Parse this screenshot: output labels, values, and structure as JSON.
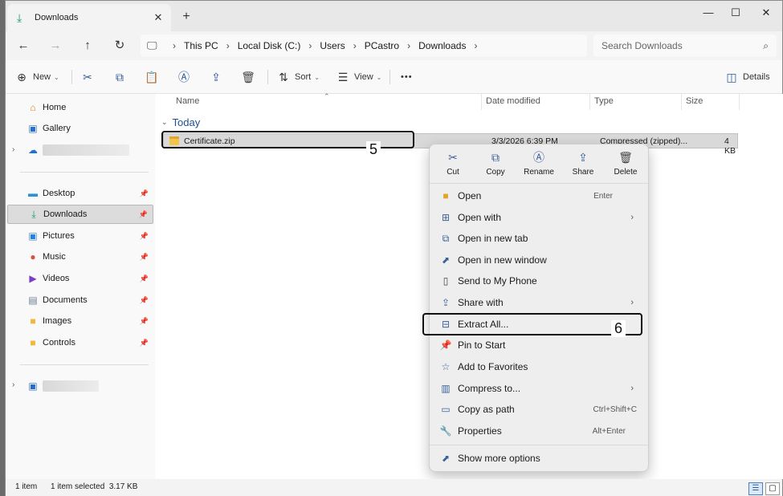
{
  "tab": {
    "title": "Downloads",
    "close": "✕",
    "new": "+"
  },
  "window_controls": {
    "minimize": "—",
    "maximize": "☐",
    "close": "✕"
  },
  "nav": {
    "back": "←",
    "forward": "→",
    "up": "↑",
    "refresh": "↻"
  },
  "breadcrumb": {
    "items": [
      "This PC",
      "Local Disk (C:)",
      "Users",
      "PCastro",
      "Downloads"
    ]
  },
  "search": {
    "placeholder": "Search Downloads"
  },
  "toolbar": {
    "new_label": "New",
    "sort_label": "Sort",
    "view_label": "View",
    "more_label": "•••",
    "details_label": "Details"
  },
  "sidebar": {
    "home": "Home",
    "gallery": "Gallery",
    "desktop": "Desktop",
    "downloads": "Downloads",
    "pictures": "Pictures",
    "music": "Music",
    "videos": "Videos",
    "documents": "Documents",
    "images": "Images",
    "controls": "Controls"
  },
  "columns": {
    "name": "Name",
    "date": "Date modified",
    "type": "Type",
    "size": "Size"
  },
  "group": {
    "label": "Today"
  },
  "file": {
    "name": "Certificate.zip",
    "date": "3/3/2026 6:39 PM",
    "type": "Compressed (zipped)...",
    "size": "4 KB"
  },
  "callouts": {
    "first": "5",
    "second": "6"
  },
  "context_menu": {
    "quick": {
      "cut": "Cut",
      "copy": "Copy",
      "rename": "Rename",
      "share": "Share",
      "delete": "Delete"
    },
    "open": "Open",
    "open_key": "Enter",
    "open_with": "Open with",
    "open_new_tab": "Open in new tab",
    "open_new_window": "Open in new window",
    "send_phone": "Send to My Phone",
    "share_with": "Share with",
    "extract_all": "Extract All...",
    "pin_start": "Pin to Start",
    "add_favorites": "Add to Favorites",
    "compress": "Compress to...",
    "copy_path": "Copy as path",
    "copy_path_key": "Ctrl+Shift+C",
    "properties": "Properties",
    "properties_key": "Alt+Enter",
    "more_options": "Show more options"
  },
  "status": {
    "count": "1 item",
    "selected": "1 item selected  3.17 KB"
  }
}
